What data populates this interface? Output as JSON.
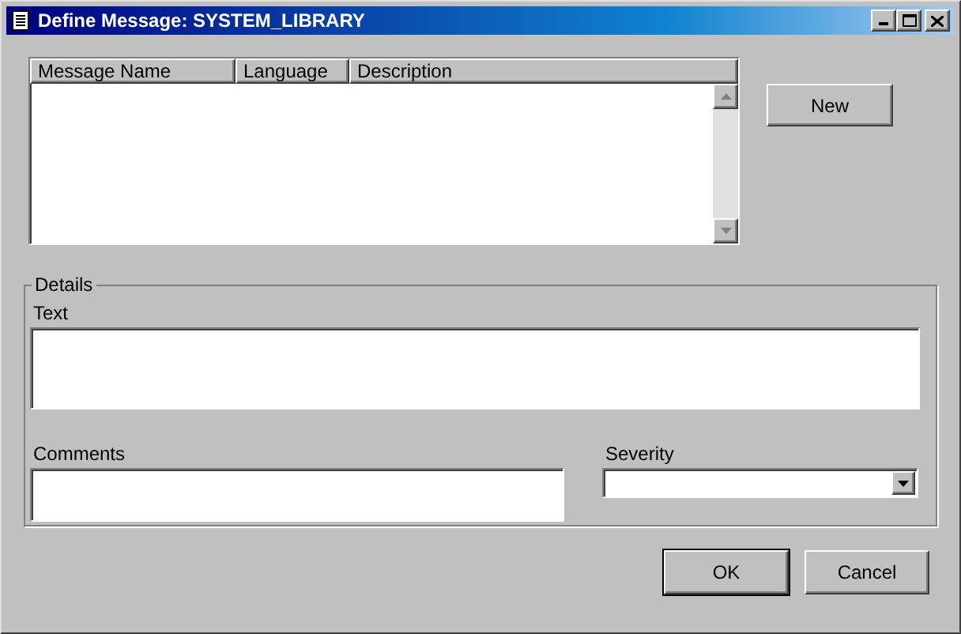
{
  "window": {
    "title": "Define Message: SYSTEM_LIBRARY"
  },
  "table": {
    "columns": [
      "Message Name",
      "Language",
      "Description"
    ]
  },
  "new_button": "New",
  "details": {
    "title": "Details",
    "text_label": "Text",
    "comments_label": "Comments",
    "severity_label": "Severity"
  },
  "buttons": [
    {
      "label": "OK",
      "default": true
    },
    {
      "label": "Cancel",
      "default": false
    }
  ]
}
